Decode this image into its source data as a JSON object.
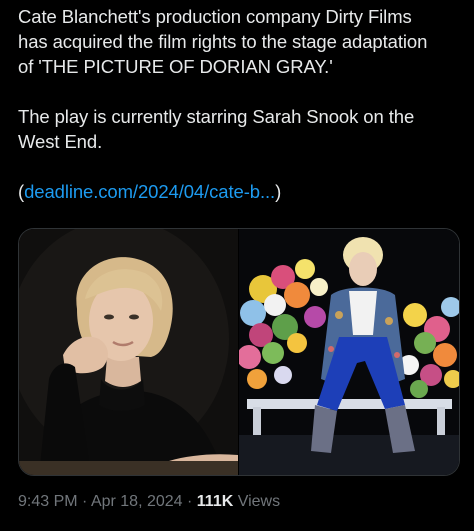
{
  "tweet": {
    "lines": [
      "Cate Blanchett's production company Dirty Films",
      "has acquired the film rights to the stage adaptation",
      "of 'THE PICTURE OF DORIAN GRAY.'",
      "The play is currently starring Sarah Snook on the",
      "West End."
    ],
    "link_open": "(",
    "link_text": "deadline.com/2024/04/cate-b...",
    "link_close": ")"
  },
  "media": {
    "photo_left_icon": "portrait-photo",
    "photo_right_icon": "stage-photo"
  },
  "meta": {
    "time": "9:43 PM",
    "sep1": " · ",
    "date": "Apr 18, 2024",
    "sep2": " · ",
    "views_count": "111K",
    "views_label": " Views"
  },
  "colors": {
    "background": "#000000",
    "text": "#e7e9ea",
    "link": "#1d9bf0",
    "muted": "#71767b"
  }
}
